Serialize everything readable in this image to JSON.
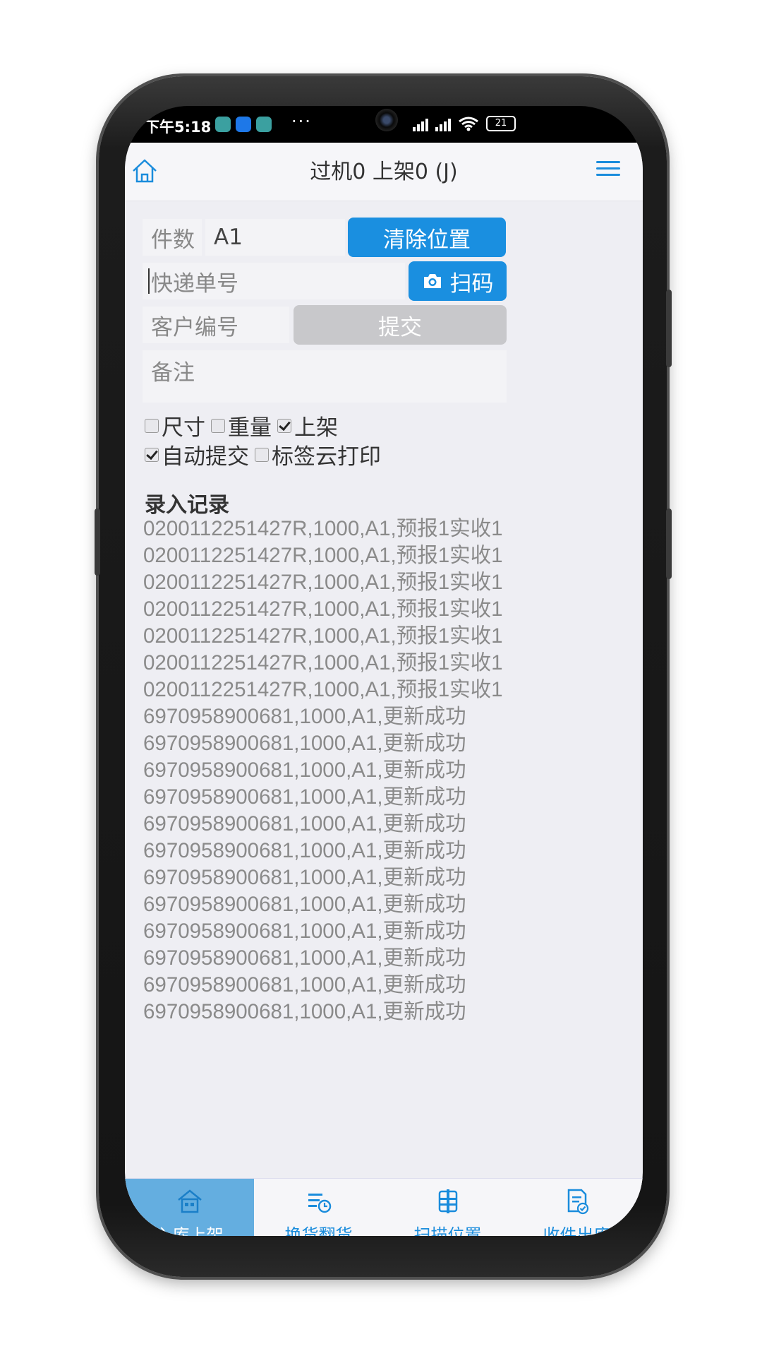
{
  "status_bar": {
    "time": "下午5:18",
    "more": "···",
    "battery": "21"
  },
  "header": {
    "title": "过机0 上架0 (J)"
  },
  "form": {
    "count_label": "件数",
    "position_value": "A1",
    "clear_position_button": "清除位置",
    "tracking_placeholder": "快递单号",
    "scan_button": "扫码",
    "customer_placeholder": "客户编号",
    "submit_button": "提交",
    "remark_placeholder": "备注"
  },
  "options": {
    "size": {
      "label": "尺寸",
      "checked": false
    },
    "weight": {
      "label": "重量",
      "checked": false
    },
    "shelve": {
      "label": "上架",
      "checked": true
    },
    "auto_submit": {
      "label": "自动提交",
      "checked": true
    },
    "cloud_print": {
      "label": "标签云打印",
      "checked": false
    }
  },
  "records": {
    "title": "录入记录",
    "lines": [
      "0200112251427R,1000,A1,预报1实收1",
      "0200112251427R,1000,A1,预报1实收1",
      "0200112251427R,1000,A1,预报1实收1",
      "0200112251427R,1000,A1,预报1实收1",
      "0200112251427R,1000,A1,预报1实收1",
      "0200112251427R,1000,A1,预报1实收1",
      "0200112251427R,1000,A1,预报1实收1",
      "6970958900681,1000,A1,更新成功",
      "6970958900681,1000,A1,更新成功",
      "6970958900681,1000,A1,更新成功",
      "6970958900681,1000,A1,更新成功",
      "6970958900681,1000,A1,更新成功",
      "6970958900681,1000,A1,更新成功",
      "6970958900681,1000,A1,更新成功",
      "6970958900681,1000,A1,更新成功",
      "6970958900681,1000,A1,更新成功",
      "6970958900681,1000,A1,更新成功",
      "6970958900681,1000,A1,更新成功",
      "6970958900681,1000,A1,更新成功"
    ]
  },
  "bottom_nav": {
    "items": [
      {
        "label": "入库上架",
        "icon": "warehouse-icon",
        "active": true
      },
      {
        "label": "换货翻货",
        "icon": "list-clock-icon",
        "active": false
      },
      {
        "label": "扫描位置",
        "icon": "shelf-icon",
        "active": false
      },
      {
        "label": "收件出库",
        "icon": "doc-check-icon",
        "active": false
      }
    ]
  },
  "colors": {
    "accent": "#1a8fe0",
    "nav_active": "#64aee0",
    "disabled_button": "#c8c8cb",
    "background": "#eeeef3"
  }
}
